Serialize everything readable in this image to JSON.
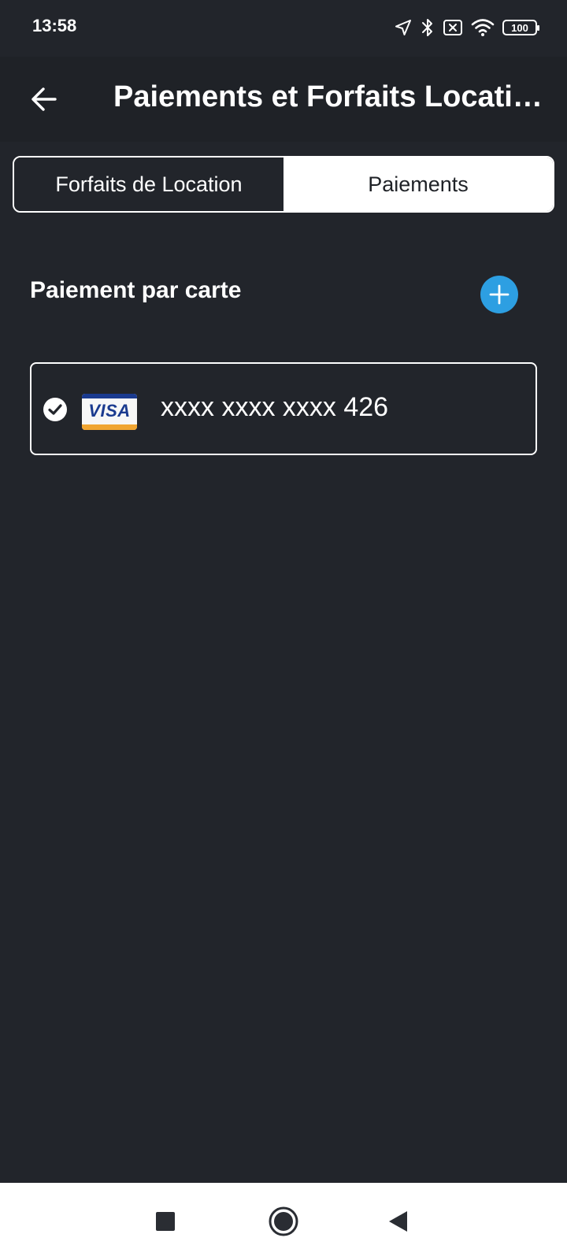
{
  "status_bar": {
    "time": "13:58",
    "battery": "100",
    "icons": [
      "location-icon",
      "bluetooth-icon",
      "sim-off-icon",
      "wifi-icon",
      "battery-icon"
    ]
  },
  "app_bar": {
    "title": "Paiements et Forfaits Location de Vélos"
  },
  "tabs": [
    {
      "label": "Forfaits de Location",
      "active": false
    },
    {
      "label": "Paiements",
      "active": true
    }
  ],
  "payments": {
    "section_title": "Paiement par carte",
    "cards": [
      {
        "brand": "VISA",
        "number": "xxxx xxxx xxxx 426",
        "selected": true
      }
    ]
  },
  "colors": {
    "background": "#22252b",
    "app_bar": "#1f2227",
    "accent": "#2d9fe2",
    "visa_blue": "#1a3a8f",
    "visa_gold": "#f0a531"
  },
  "nav_bar": {
    "icons": [
      "recents-icon",
      "home-icon",
      "back-nav-icon"
    ]
  }
}
